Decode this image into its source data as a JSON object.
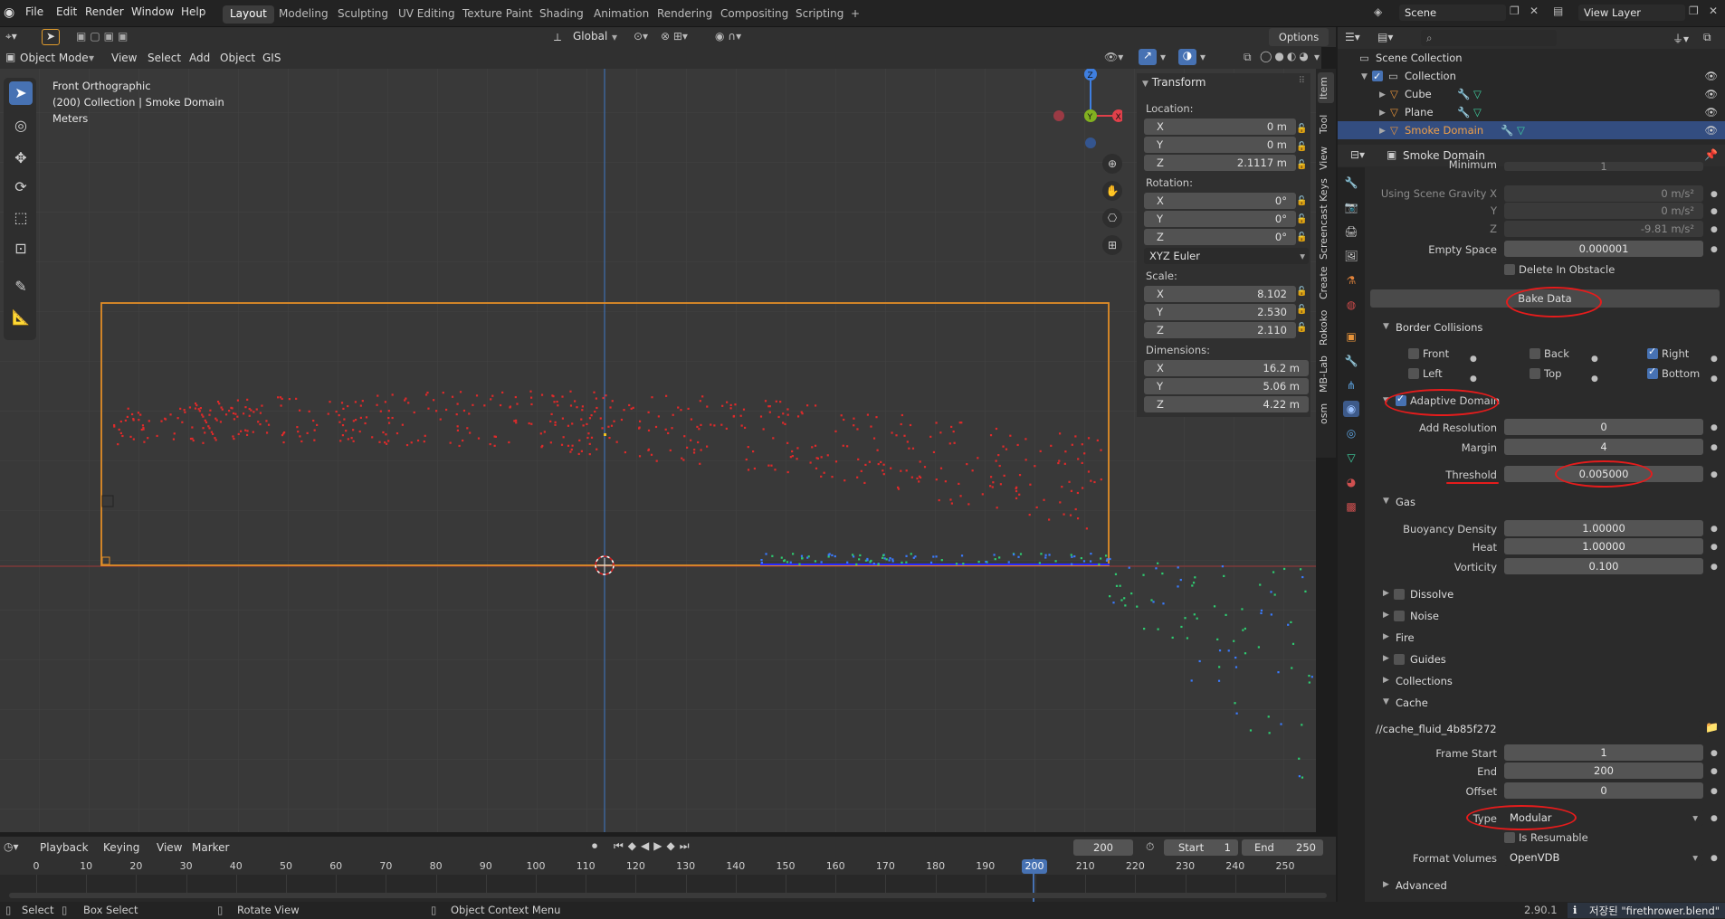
{
  "topbar": {
    "menus": [
      "File",
      "Edit",
      "Render",
      "Window",
      "Help"
    ],
    "workspaces": [
      "Layout",
      "Modeling",
      "Sculpting",
      "UV Editing",
      "Texture Paint",
      "Shading",
      "Animation",
      "Rendering",
      "Compositing",
      "Scripting"
    ],
    "active_workspace": "Layout",
    "add_tab": "+",
    "scene": "Scene",
    "view_layer": "View Layer"
  },
  "tool_header": {
    "orientation": "Global",
    "options": "Options"
  },
  "view_header": {
    "mode": "Object Mode",
    "menus": [
      "View",
      "Select",
      "Add",
      "Object",
      "GIS"
    ]
  },
  "viewport": {
    "info_line1": "Front Orthographic",
    "info_line2": "(200) Collection | Smoke Domain",
    "info_line3": "Meters",
    "gizmo_z": "Z",
    "gizmo_y": "Y",
    "gizmo_x": "X"
  },
  "npanel": {
    "header": "Transform",
    "location_label": "Location:",
    "location": [
      {
        "axis": "X",
        "value": "0 m"
      },
      {
        "axis": "Y",
        "value": "0 m"
      },
      {
        "axis": "Z",
        "value": "2.1117 m"
      }
    ],
    "rotation_label": "Rotation:",
    "rotation": [
      {
        "axis": "X",
        "value": "0°"
      },
      {
        "axis": "Y",
        "value": "0°"
      },
      {
        "axis": "Z",
        "value": "0°"
      }
    ],
    "rotation_mode": "XYZ Euler",
    "scale_label": "Scale:",
    "scale": [
      {
        "axis": "X",
        "value": "8.102"
      },
      {
        "axis": "Y",
        "value": "2.530"
      },
      {
        "axis": "Z",
        "value": "2.110"
      }
    ],
    "dimensions_label": "Dimensions:",
    "dimensions": [
      {
        "axis": "X",
        "value": "16.2 m"
      },
      {
        "axis": "Y",
        "value": "5.06 m"
      },
      {
        "axis": "Z",
        "value": "4.22 m"
      }
    ]
  },
  "vtabs": [
    "Item",
    "Tool",
    "View",
    "Screencast Keys",
    "Create",
    "Rokoko",
    "MB-Lab",
    "osm"
  ],
  "outliner": {
    "root": "Scene Collection",
    "collection": "Collection",
    "items": [
      "Cube",
      "Plane",
      "Smoke Domain"
    ]
  },
  "properties": {
    "object_name": "Smoke Domain",
    "minimum_label": "Minimum",
    "minimum": "1",
    "gravity_x_label": "Using Scene Gravity X",
    "gravity_x": "0 m/s²",
    "gravity_y_label": "Y",
    "gravity_y": "0 m/s²",
    "gravity_z_label": "Z",
    "gravity_z": "-9.81 m/s²",
    "empty_space_label": "Empty Space",
    "empty_space": "0.000001",
    "delete_obstacle": "Delete In Obstacle",
    "bake_data": "Bake Data",
    "border_collisions": "Border Collisions",
    "front": "Front",
    "back": "Back",
    "right": "Right",
    "left": "Left",
    "top": "Top",
    "bottom": "Bottom",
    "adaptive_domain": "Adaptive Domain",
    "add_resolution_label": "Add Resolution",
    "add_resolution": "0",
    "margin_label": "Margin",
    "margin": "4",
    "threshold_label": "Threshold",
    "threshold": "0.005000",
    "gas": "Gas",
    "buoyancy_label": "Buoyancy Density",
    "buoyancy": "1.00000",
    "heat_label": "Heat",
    "heat": "1.00000",
    "vorticity_label": "Vorticity",
    "vorticity": "0.100",
    "dissolve": "Dissolve",
    "noise": "Noise",
    "fire": "Fire",
    "guides": "Guides",
    "collections": "Collections",
    "cache": "Cache",
    "cache_path": "//cache_fluid_4b85f272",
    "frame_start_label": "Frame Start",
    "frame_start": "1",
    "end_label": "End",
    "end": "200",
    "offset_label": "Offset",
    "offset": "0",
    "type_label": "Type",
    "type": "Modular",
    "is_resumable": "Is Resumable",
    "format_label": "Format Volumes",
    "format": "OpenVDB",
    "advanced": "Advanced"
  },
  "timeline": {
    "menus": [
      "Playback",
      "Keying",
      "View",
      "Marker"
    ],
    "current_frame": "200",
    "start_label": "Start",
    "start": "1",
    "end_label": "End",
    "end": "250",
    "ticks": [
      "0",
      "10",
      "20",
      "30",
      "40",
      "50",
      "60",
      "70",
      "80",
      "90",
      "100",
      "110",
      "120",
      "130",
      "140",
      "150",
      "160",
      "170",
      "180",
      "190",
      "200",
      "210",
      "220",
      "230",
      "240",
      "250"
    ]
  },
  "status": {
    "select": "Select",
    "box_select": "Box Select",
    "rotate_view": "Rotate View",
    "context_menu": "Object Context Menu",
    "version": "2.90.1",
    "saved": "저장된 \"firethrower.blend\""
  }
}
